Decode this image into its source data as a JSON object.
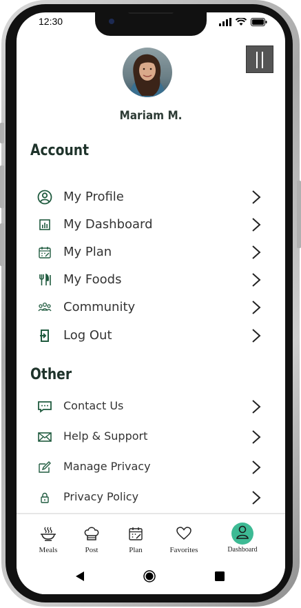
{
  "status_bar": {
    "time": "12:30"
  },
  "profile": {
    "name": "Mariam M."
  },
  "sections": {
    "account_heading": "Account",
    "other_heading": "Other"
  },
  "account_items": [
    {
      "label": "My Profile",
      "icon": "user-circle-icon"
    },
    {
      "label": "My Dashboard",
      "icon": "dashboard-chart-icon"
    },
    {
      "label": "My Plan",
      "icon": "calendar-plan-icon"
    },
    {
      "label": "My Foods",
      "icon": "fork-knife-icon"
    },
    {
      "label": "Community",
      "icon": "community-people-icon"
    },
    {
      "label": "Log Out",
      "icon": "logout-icon"
    }
  ],
  "other_items": [
    {
      "label": "Contact Us",
      "icon": "chat-message-icon"
    },
    {
      "label": "Help & Support",
      "icon": "envelope-icon"
    },
    {
      "label": "Manage Privacy",
      "icon": "edit-pencil-icon"
    },
    {
      "label": "Privacy Policy",
      "icon": "lock-icon"
    }
  ],
  "tab_bar": {
    "tabs": [
      {
        "label": "Meals",
        "icon": "bowl-icon",
        "active": false
      },
      {
        "label": "Post",
        "icon": "chef-hat-icon",
        "active": false
      },
      {
        "label": "Plan",
        "icon": "calendar-icon",
        "active": false
      },
      {
        "label": "Favorites",
        "icon": "heart-icon",
        "active": false
      },
      {
        "label": "Dashboard",
        "icon": "person-icon",
        "active": true
      }
    ]
  },
  "colors": {
    "accent": "#3dba94",
    "icon_green": "#1f5a3e",
    "heading": "#1f332b"
  }
}
